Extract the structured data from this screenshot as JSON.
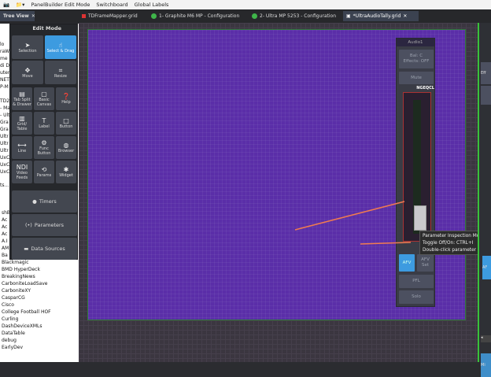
{
  "toolbar": {
    "items": [
      "PanelBuilder Edit Mode",
      "Switchboard",
      "Global Labels"
    ]
  },
  "tree_view": {
    "title": "Tree View",
    "top_fragments": [
      "lo",
      "raW",
      "me",
      "di D",
      "uter",
      "NET",
      "P-M"
    ],
    "mid_fragments": [
      "TD2",
      "- Ma",
      "- Ult",
      "Gra",
      "Gra",
      "Ultr",
      "Ultr",
      "Ultr",
      "UxC",
      "UxC",
      "UxC"
    ],
    "more": "ts...",
    "list": [
      "shB",
      "Ac",
      "Ac",
      "Ac",
      "A.I",
      "AM",
      "Ba",
      "Blackmagic",
      "BMD HyperDeck",
      "BreakingNews",
      "CarboniteLoadSave",
      "CarboniteXY",
      "CasparCG",
      "Cisco",
      "College Football HOF",
      "Curling",
      "DashDeviceXMLs",
      "DataTable",
      "debug",
      "EarlyDev"
    ]
  },
  "tabs": [
    {
      "label": "TDFrameMapper.grid",
      "status": "error"
    },
    {
      "label": "1- Graphite M6 MP - Configuration",
      "status": "ok"
    },
    {
      "label": "2- Ultra MP 5253 - Configuration",
      "status": "ok"
    },
    {
      "label": "*UltraAudioTally.grid",
      "status": "active"
    }
  ],
  "edit_mode": {
    "title": "Edit Mode",
    "tools": [
      {
        "label": "Selection",
        "icon": "cursor"
      },
      {
        "label": "Select & Drag",
        "icon": "hand",
        "selected": true
      },
      {
        "label": "Move",
        "icon": "move"
      },
      {
        "label": "Resize",
        "icon": "resize"
      },
      {
        "label": "Tab Split & Drawer",
        "icon": "tab"
      },
      {
        "label": "Basic Canvas",
        "icon": "canvas"
      },
      {
        "label": "Help",
        "icon": "help"
      },
      {
        "label": "Grid/ Table",
        "icon": "grid"
      },
      {
        "label": "Label",
        "icon": "T"
      },
      {
        "label": "Button",
        "icon": "button"
      },
      {
        "label": "Line",
        "icon": "line"
      },
      {
        "label": "Func Button",
        "icon": "func"
      },
      {
        "label": "Browser",
        "icon": "globe"
      },
      {
        "label": "Video Feeds",
        "icon": "NDI"
      },
      {
        "label": "Params",
        "icon": "params"
      },
      {
        "label": "Widget",
        "icon": "widget"
      }
    ],
    "sections": [
      "Timers",
      "Parameters",
      "Data Sources"
    ]
  },
  "audio_strip": {
    "title": "Audio1",
    "bal": "Bal: C\nEffects: OFF",
    "mute": "Mute",
    "label": "NGEQCL",
    "afv": "AFV",
    "afv_set": "AFV Set",
    "pfl": "PFL",
    "solo": "Solo",
    "fader_level": 0.12
  },
  "tooltip": {
    "lines": [
      "Parameter Inspection Mode",
      "Toggle Off/On: CTRL+I",
      "Double-click parameter to insp"
    ]
  },
  "right_panel": {
    "fragments": [
      "Eff",
      "AF",
      "Mi"
    ]
  },
  "colors": {
    "canvas": "#5a2ea8",
    "selected": "#3d9be0",
    "accent_green": "#39c23a",
    "arrow": "#f07a50"
  }
}
